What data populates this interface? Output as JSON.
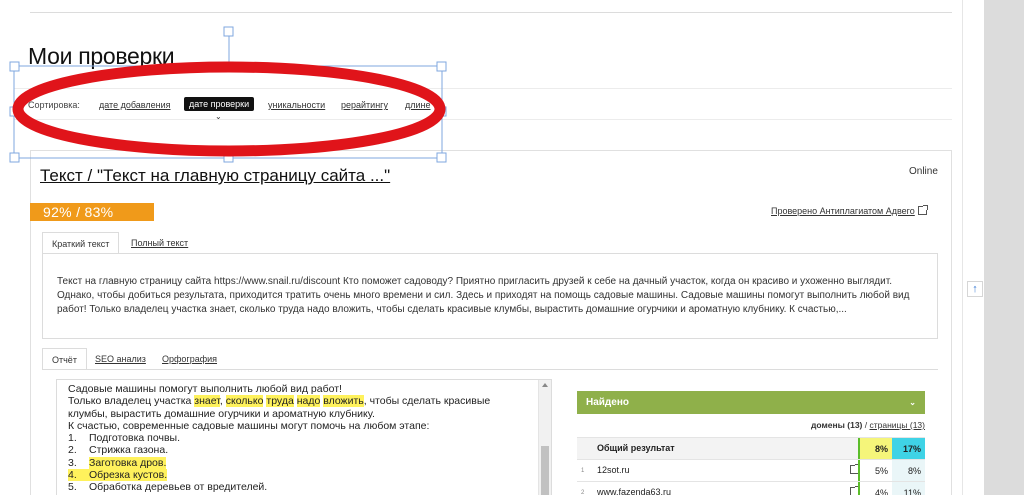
{
  "page": {
    "title": "Мои проверки"
  },
  "sort": {
    "label": "Сортировка:",
    "options": [
      {
        "label": "дате добавления",
        "active": false
      },
      {
        "label": "дате проверки",
        "active": true
      },
      {
        "label": "уникальности",
        "active": false
      },
      {
        "label": "рерайтингу",
        "active": false
      },
      {
        "label": "длине",
        "active": false
      }
    ]
  },
  "card": {
    "title": "Текст / \"Текст на главную страницу сайта ...\"",
    "status": "Online",
    "score": "92% / 83%",
    "checked_by": "Проверено Антиплагиатом Адвего",
    "text_tabs": [
      {
        "label": "Краткий текст",
        "active": true
      },
      {
        "label": "Полный текст",
        "active": false
      }
    ],
    "short_text": "Текст на главную страницу сайта https://www.snail.ru/discount Кто поможет садоводу? Приятно пригласить друзей к себе на дачный участок, когда он красиво и ухоженно выглядит. Однако, чтобы добиться результата, приходится тратить очень много времени и сил. Здесь и приходят на помощь садовые машины. Садовые машины помогут выполнить любой вид работ! Только владелец участка знает, сколько труда надо вложить, чтобы сделать красивые клумбы, вырастить домашние огурчики и ароматную клубнику. К счастью,...",
    "report_tabs": [
      {
        "label": "Отчёт",
        "active": true
      },
      {
        "label": "SEO анализ",
        "active": false
      },
      {
        "label": "Орфография",
        "active": false
      }
    ]
  },
  "report": {
    "line1": "Садовые машины помогут выполнить  любой вид работ!",
    "line2_pre": "Только владелец участка ",
    "line2_hl1": "знает",
    "line2_sep1": ", ",
    "line2_hl2": "сколько",
    "line2_sp1": " ",
    "line2_hl3": "труда",
    "line2_sp2": " ",
    "line2_hl4": "надо",
    "line2_sp3": " ",
    "line2_hl5": "вложить",
    "line2_post": ", чтобы сделать красивые",
    "line3": "клумбы, вырастить домашние огурчики и ароматную клубнику.",
    "line4": "К счастью, современные садовые машины могут помочь на любом этапе:",
    "list": [
      {
        "num": "1.",
        "text": "Подготовка  почвы.",
        "highlight": false
      },
      {
        "num": "2.",
        "text": "Стрижка газона.",
        "highlight": false
      },
      {
        "num": "3.",
        "text": "Заготовка  дров.",
        "highlight": true
      },
      {
        "num": "4.",
        "text": "Обрезка кустов.",
        "highlight": true
      },
      {
        "num": "5.",
        "text": "Обработка деревьев от вредителей.",
        "highlight": false
      }
    ]
  },
  "found": {
    "title": "Найдено",
    "domains_label": "домены (13)",
    "separator": " / ",
    "pages_label": "страницы (13)",
    "total": {
      "name": "Общий результат",
      "p1": "8%",
      "p2": "17%"
    },
    "rows": [
      {
        "idx": "1",
        "name": "12sot.ru",
        "p1": "5%",
        "p2": "8%"
      },
      {
        "idx": "2",
        "name": "www.fazenda63.ru",
        "p1": "4%",
        "p2": "11%"
      }
    ]
  },
  "colors": {
    "score_badge": "#f09a1a",
    "found_header": "#8fb04a",
    "highlight": "#fff25c",
    "annotation_ellipse": "#e0141a",
    "selection_box": "#7fa7df"
  },
  "icons": {
    "scroll_top": "↑",
    "external_link": "external-link-icon",
    "chevron": "chevron-down-icon"
  }
}
